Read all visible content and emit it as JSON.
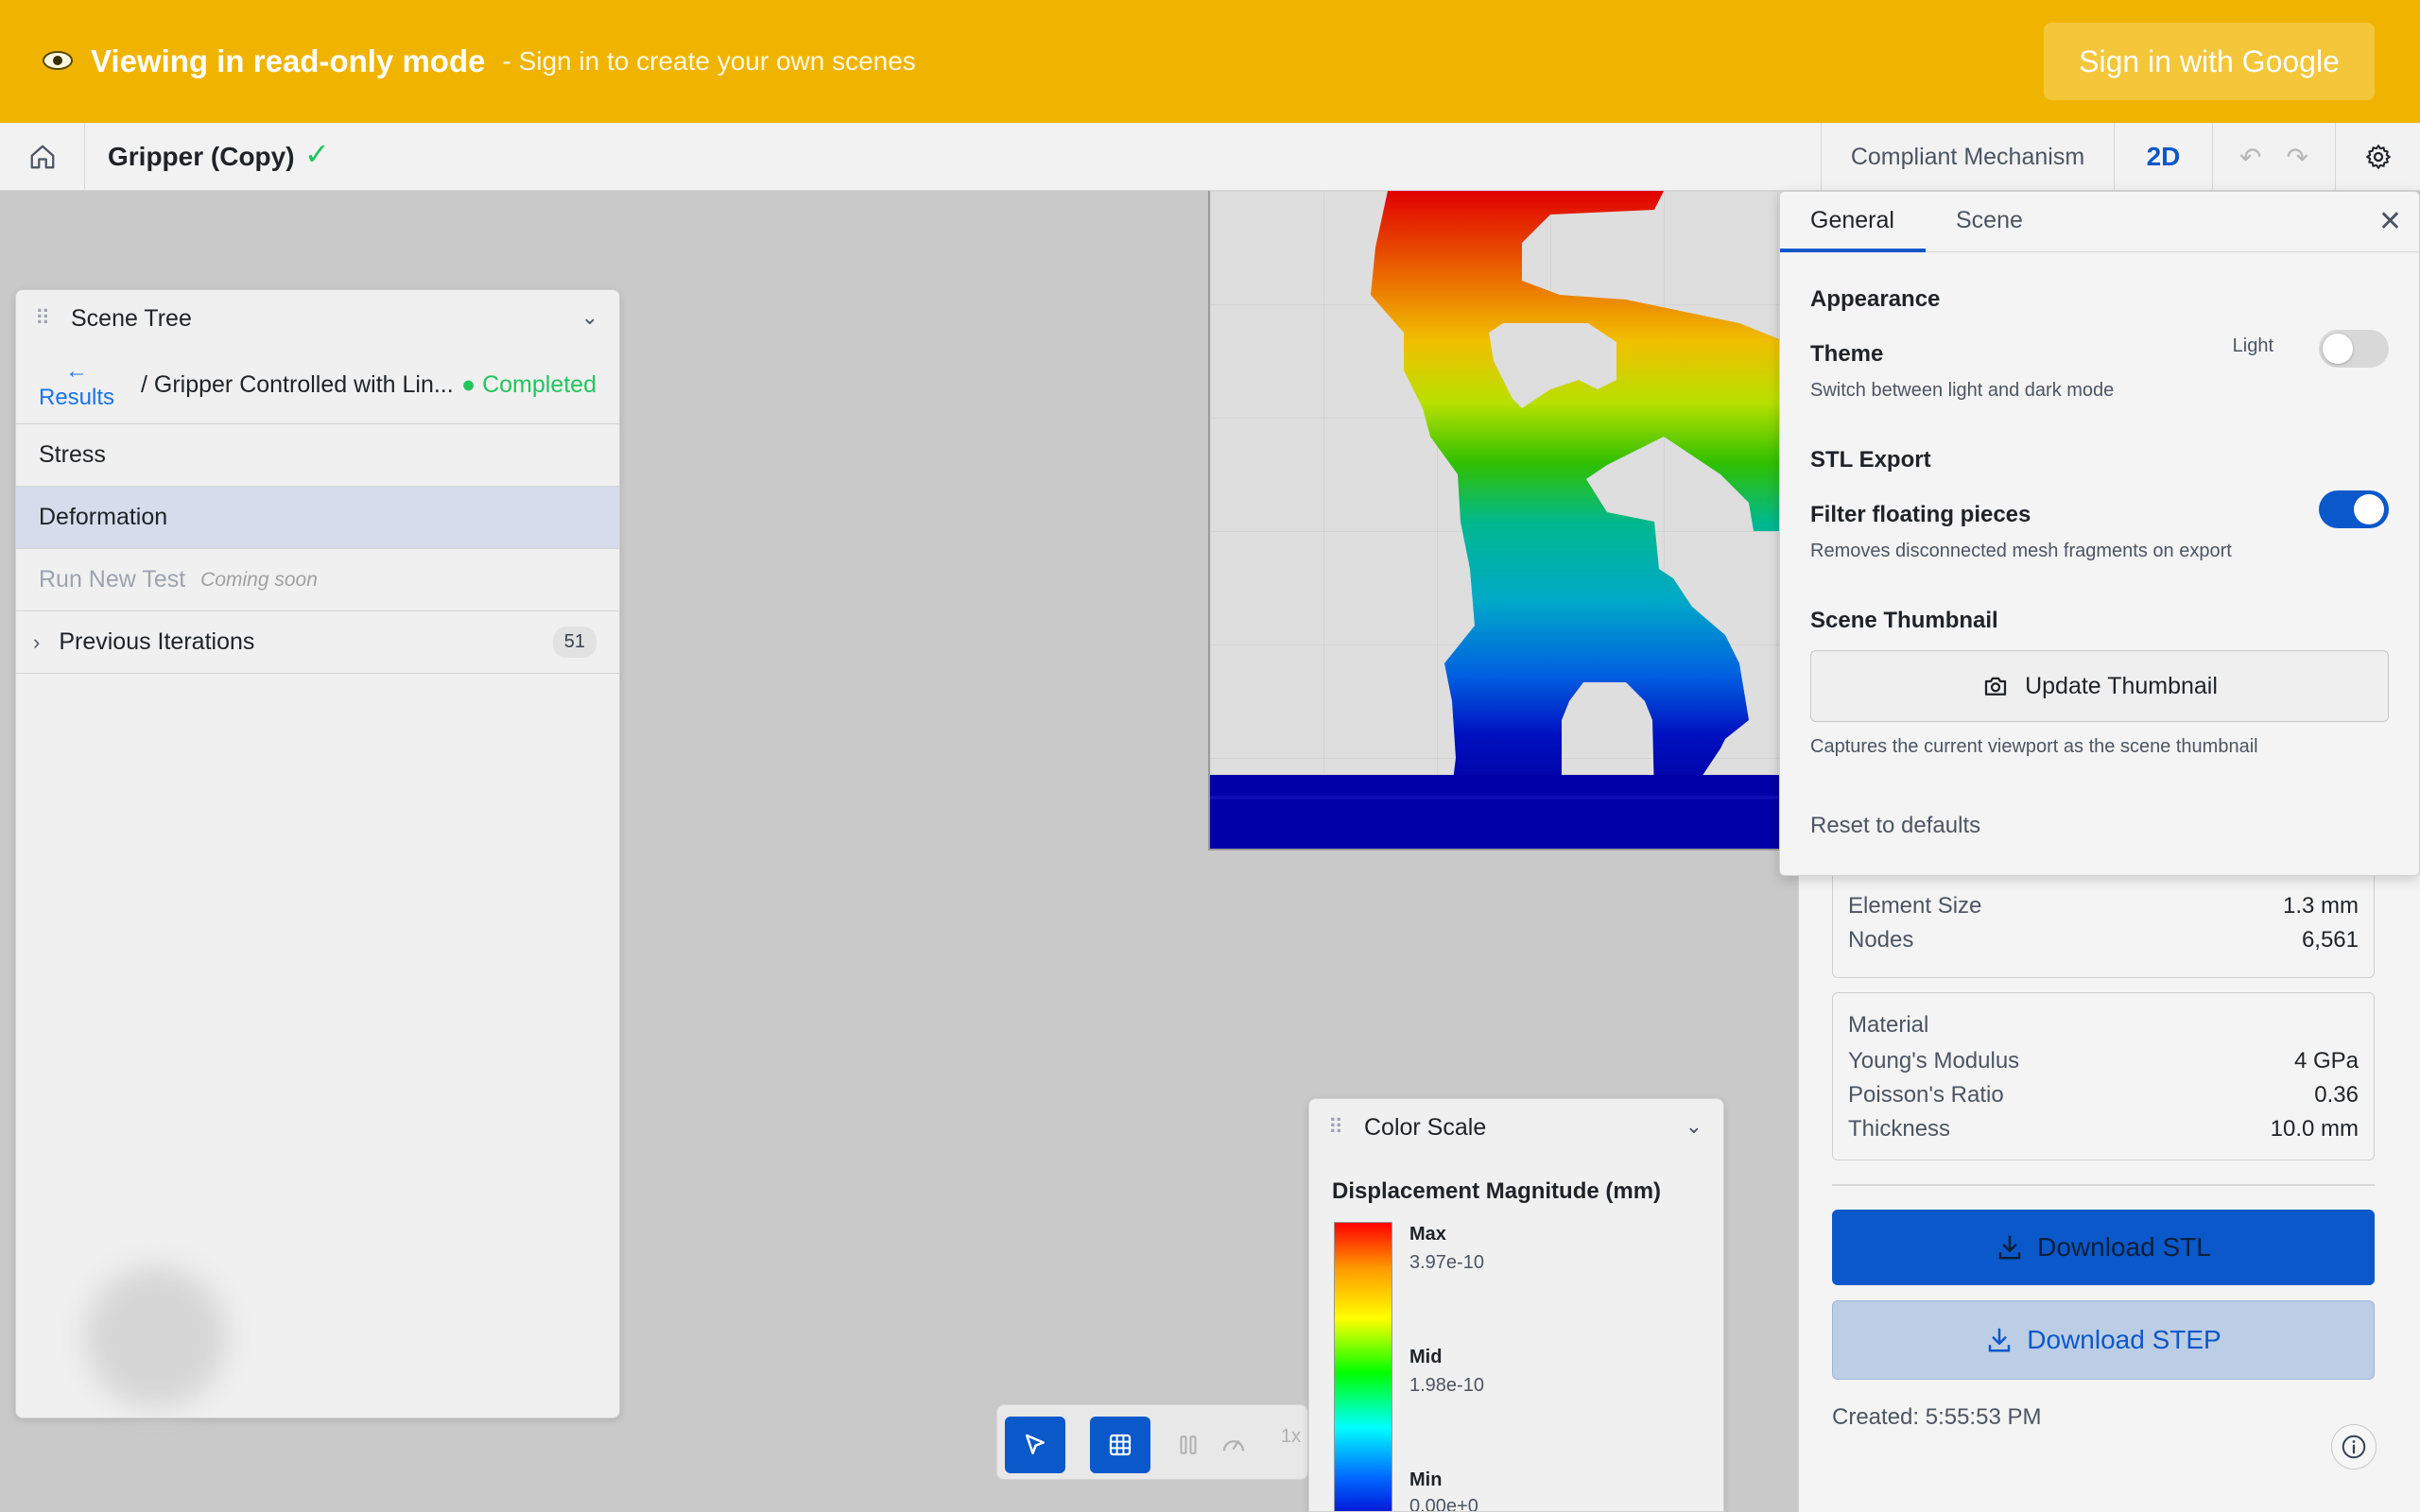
{
  "banner": {
    "icon": "eye-icon",
    "title": "Viewing in read-only mode",
    "subtitle": "- Sign in to create your own scenes",
    "signin_label": "Sign in with Google"
  },
  "topbar": {
    "doc_title": "Gripper (Copy)",
    "mode_label": "Compliant Mechanism",
    "dim_label": "2D"
  },
  "scene_tree": {
    "title": "Scene Tree",
    "back_label": "Results",
    "path": "/ Gripper Controlled with Lin...",
    "status": "Completed",
    "items": [
      {
        "label": "Stress"
      },
      {
        "label": "Deformation",
        "selected": true
      },
      {
        "label": "Run New Test",
        "note": "Coming soon"
      }
    ],
    "previous": {
      "label": "Previous Iterations",
      "count": "51"
    }
  },
  "settings": {
    "tabs": [
      "General",
      "Scene"
    ],
    "appearance_title": "Appearance",
    "theme_label": "Theme",
    "theme_desc": "Switch between light and dark mode",
    "theme_state": "Light",
    "stl_title": "STL Export",
    "filter_label": "Filter floating pieces",
    "filter_desc": "Removes disconnected mesh fragments on export",
    "thumb_title": "Scene Thumbnail",
    "thumb_button": "Update Thumbnail",
    "thumb_desc": "Captures the current viewport as the scene thumbnail",
    "reset_label": "Reset to defaults"
  },
  "info": {
    "mesh": {
      "element_size_label": "Element Size",
      "element_size": "1.3 mm",
      "nodes_label": "Nodes",
      "nodes": "6,561"
    },
    "material": {
      "title": "Material",
      "youngs_label": "Young's Modulus",
      "youngs": "4 GPa",
      "poisson_label": "Poisson's Ratio",
      "poisson": "0.36",
      "thickness_label": "Thickness",
      "thickness": "10.0 mm"
    },
    "download_stl": "Download STL",
    "download_step": "Download STEP",
    "created": "Created: 5:55:53 PM"
  },
  "color_scale": {
    "title": "Color Scale",
    "label": "Displacement Magnitude (mm)",
    "max_label": "Max",
    "max_value": "3.97e-10",
    "mid_label": "Mid",
    "mid_value": "1.98e-10",
    "min_label": "Min",
    "min_value": "0.00e+0"
  },
  "toolbar": {
    "speed": "1x"
  },
  "colors": {
    "banner": "#f0b400",
    "accent": "#0a58ca",
    "success": "#22c55e"
  }
}
